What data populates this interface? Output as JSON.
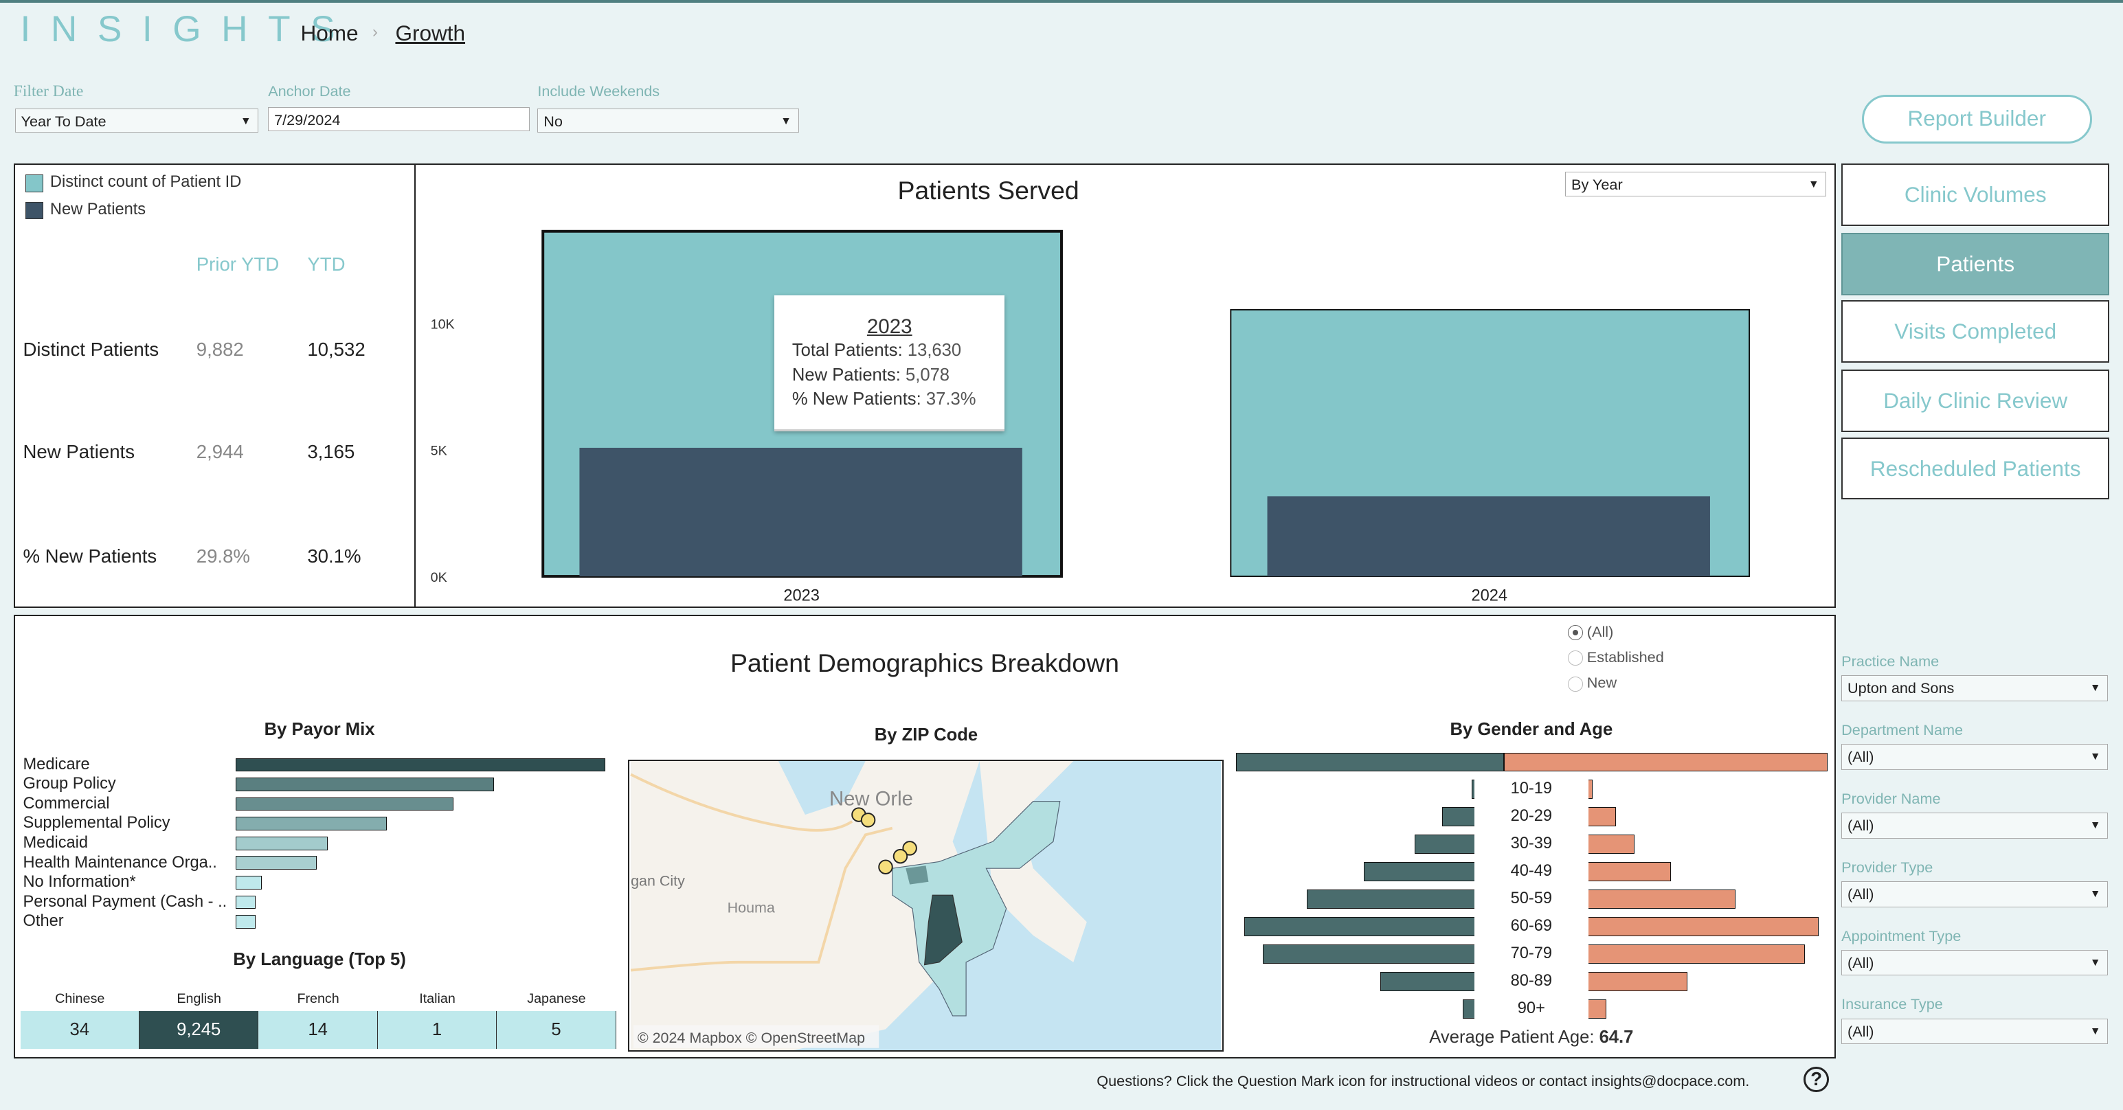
{
  "header": {
    "logo": "INSIGHTS",
    "breadcrumb": [
      "Home",
      "Growth"
    ]
  },
  "filters": {
    "filter_date": {
      "label": "Filter Date",
      "value": "Year To Date"
    },
    "anchor_date": {
      "label": "Anchor Date",
      "value": "7/29/2024"
    },
    "include_weekends": {
      "label": "Include Weekends",
      "value": "No"
    }
  },
  "report_builder": "Report Builder",
  "nav": [
    {
      "label": "Clinic Volumes",
      "active": false
    },
    {
      "label": "Patients",
      "active": true
    },
    {
      "label": "Visits Completed",
      "active": false
    },
    {
      "label": "Daily Clinic Review",
      "active": false
    },
    {
      "label": "Rescheduled Patients",
      "active": false
    }
  ],
  "kpi": {
    "legend": [
      {
        "label": "Distinct count of Patient ID",
        "color": "#84c6c9"
      },
      {
        "label": "New Patients",
        "color": "#3e5468"
      }
    ],
    "col_prior": "Prior YTD",
    "col_ytd": "YTD",
    "rows": [
      {
        "label": "Distinct Patients",
        "prior": "9,882",
        "ytd": "10,532"
      },
      {
        "label": "New Patients",
        "prior": "2,944",
        "ytd": "3,165"
      },
      {
        "label": "% New Patients",
        "prior": "29.8%",
        "ytd": "30.1%"
      }
    ]
  },
  "chart_data": [
    {
      "type": "bar",
      "title": "Patients Served",
      "categories": [
        "2023",
        "2024"
      ],
      "series": [
        {
          "name": "Distinct count of Patient ID",
          "values": [
            13630,
            10532
          ],
          "color": "#84c6c9"
        },
        {
          "name": "New Patients",
          "values": [
            5078,
            3165
          ],
          "color": "#3e5468"
        }
      ],
      "yticks": [
        "0K",
        "5K",
        "10K"
      ],
      "ylim": [
        0,
        14000
      ],
      "grid": false,
      "tooltip": {
        "title": "2023",
        "lines": [
          [
            "Total Patients:",
            "13,630"
          ],
          [
            "New Patients:",
            "5,078"
          ],
          [
            "% New Patients:",
            "37.3%"
          ]
        ]
      },
      "period_select": "By Year"
    },
    {
      "type": "bar",
      "title": "By Payor Mix",
      "orientation": "horizontal",
      "categories": [
        "Medicare",
        "Group Policy",
        "Commercial",
        "Supplemental Policy",
        "Medicaid",
        "Health Maintenance Orga..",
        "No Information*",
        "Personal Payment (Cash - ..",
        "Other"
      ],
      "relative_values": [
        1.0,
        0.7,
        0.59,
        0.41,
        0.25,
        0.22,
        0.07,
        0.05,
        0.05
      ],
      "colors": [
        "#2f4f51",
        "#5a7f80",
        "#688e8f",
        "#84adae",
        "#a3cbcc",
        "#a9cfd0",
        "#bfe9ec",
        "#bfe9ec",
        "#bfe9ec"
      ]
    },
    {
      "type": "bar",
      "title": "By Gender and Age",
      "orientation": "horizontal-diverging",
      "categories": [
        "10-19",
        "20-29",
        "30-39",
        "40-49",
        "50-59",
        "60-69",
        "70-79",
        "80-89",
        "90+"
      ],
      "series": [
        {
          "side": "left",
          "color": "#4a6c6d",
          "relative_values": [
            0.01,
            0.14,
            0.26,
            0.48,
            0.73,
            1.0,
            0.92,
            0.41,
            0.05
          ]
        },
        {
          "side": "right",
          "color": "#e59476",
          "relative_values": [
            0.02,
            0.12,
            0.2,
            0.36,
            0.64,
            1.0,
            0.94,
            0.43,
            0.08
          ]
        }
      ],
      "total_split": [
        0.453,
        0.547
      ],
      "footer_label": "Average Patient Age:",
      "footer_value": "64.7"
    }
  ],
  "demographics": {
    "title": "Patient Demographics Breakdown",
    "patient_type": {
      "options": [
        "(All)",
        "Established",
        "New"
      ],
      "selected": "(All)"
    },
    "language": {
      "title": "By Language (Top 5)",
      "headers": [
        "Chinese",
        "English",
        "French",
        "Italian",
        "Japanese"
      ],
      "values": [
        "34",
        "9,245",
        "14",
        "1",
        "5"
      ],
      "highlight": "English"
    },
    "map": {
      "title": "By ZIP Code",
      "labels": [
        "New Orle",
        "gan City",
        "Houma"
      ],
      "attribution": "© 2024 Mapbox  © OpenStreetMap"
    }
  },
  "right_filters": [
    {
      "label": "Practice Name",
      "value": "Upton and Sons"
    },
    {
      "label": "Department Name",
      "value": "(All)"
    },
    {
      "label": "Provider Name",
      "value": "(All)"
    },
    {
      "label": "Provider Type",
      "value": "(All)"
    },
    {
      "label": "Appointment Type",
      "value": "(All)"
    },
    {
      "label": "Insurance Type",
      "value": "(All)"
    }
  ],
  "footer": {
    "text": "Questions? Click the Question Mark icon for instructional videos or contact insights@docpace.com.",
    "help_icon": "question-circle-icon"
  }
}
